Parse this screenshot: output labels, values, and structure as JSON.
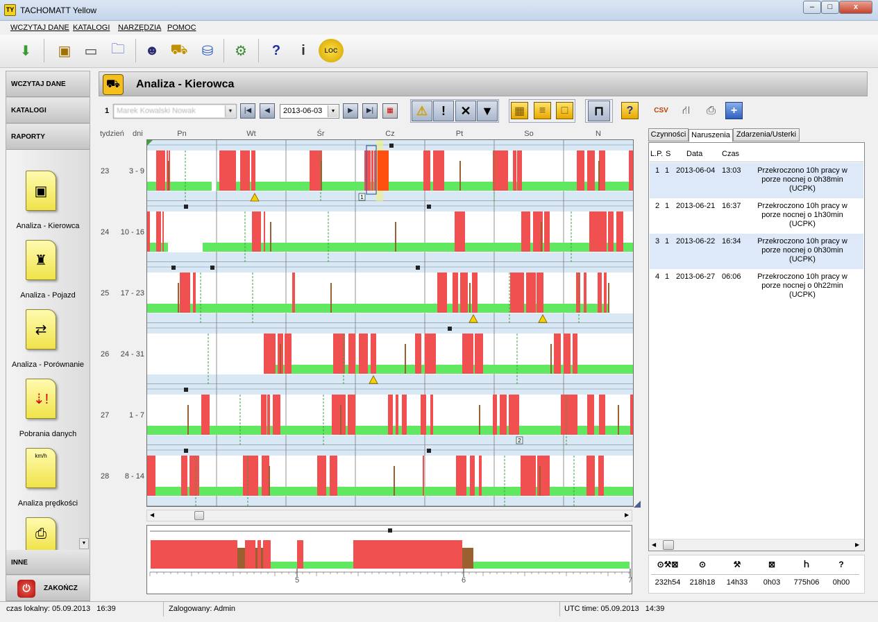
{
  "window": {
    "title": "TACHOMATT Yellow",
    "minimize": "–",
    "maximize": "□",
    "close": "x"
  },
  "menu": [
    "WCZYTAJ DANE",
    "KATALOGI",
    "NARZĘDZIA",
    "POMOC"
  ],
  "toolbar": {
    "icons": [
      "download-icon",
      "card-reader-icon",
      "card-icon",
      "folder-open-icon",
      "driver-icon",
      "truck-icon",
      "database-icon",
      "settings-gears-icon",
      "help-icon",
      "info-icon",
      "loc-clock-icon"
    ],
    "loc_label": "LOC"
  },
  "sidebar": {
    "sections": [
      "WCZYTAJ DANE",
      "KATALOGI",
      "RAPORTY"
    ],
    "reports": [
      {
        "label": "Analiza - Kierowca",
        "icon": "driver-analysis-icon"
      },
      {
        "label": "Analiza - Pojazd",
        "icon": "vehicle-analysis-icon"
      },
      {
        "label": "Analiza - Porównanie",
        "icon": "comparison-icon"
      },
      {
        "label": "Pobrania danych",
        "icon": "data-download-icon"
      },
      {
        "label": "Analiza prędkości",
        "icon": "speed-analysis-icon",
        "badge": "km/h"
      },
      {
        "label": "",
        "icon": "printer-icon"
      }
    ],
    "inne": "INNE",
    "exit": "ZAKOŃCZ"
  },
  "header": {
    "title": "Analiza - Kierowca"
  },
  "controls": {
    "driver_number": "1",
    "driver_name": "Marek Kowalski Nowak",
    "date": "2013-06-03",
    "buttons": [
      "first-button",
      "prev-button",
      "next-button",
      "last-button",
      "calendar-button"
    ],
    "filters": [
      "warning-filter",
      "exclamation-filter",
      "x-filter",
      "triangle-filter"
    ],
    "views": [
      "grid-view",
      "list-view",
      "single-view"
    ]
  },
  "chart": {
    "week_col": "tydzień",
    "days_col": "dni",
    "days": [
      "Pn",
      "Wt",
      "Śr",
      "Cz",
      "Pt",
      "So",
      "N"
    ],
    "weeks": [
      {
        "week": "23",
        "range": "3 - 9"
      },
      {
        "week": "24",
        "range": "10 - 16"
      },
      {
        "week": "25",
        "range": "17 - 23"
      },
      {
        "week": "26",
        "range": "24 - 31"
      },
      {
        "week": "27",
        "range": "1 - 7"
      },
      {
        "week": "28",
        "range": "8 - 14"
      }
    ],
    "markers": [
      "1",
      "2"
    ],
    "colors": {
      "driving": "#f05050",
      "rest": "#60e860",
      "work": "#9a6030",
      "bar": "#d8e8f4"
    }
  },
  "detail": {
    "ticks": [
      "5",
      "6",
      "7"
    ]
  },
  "tabs": [
    "Czynności",
    "Naruszenia",
    "Zdarzenia/Usterki"
  ],
  "violations": {
    "headers": {
      "lp": "L.P.",
      "s": "S",
      "date": "Data",
      "time": "Czas"
    },
    "rows": [
      {
        "lp": "1",
        "s": "1",
        "date": "2013-06-04",
        "time": "13:03",
        "l1": "Przekroczono 10h pracy w",
        "l2": "porze nocnej o 0h38min",
        "l3": "(UCPK)"
      },
      {
        "lp": "2",
        "s": "1",
        "date": "2013-06-21",
        "time": "16:37",
        "l1": "Przekroczono 10h pracy w",
        "l2": "porze nocnej o 1h30min",
        "l3": "(UCPK)"
      },
      {
        "lp": "3",
        "s": "1",
        "date": "2013-06-22",
        "time": "16:34",
        "l1": "Przekroczono 10h pracy w",
        "l2": "porze nocnej o 0h30min",
        "l3": "(UCPK)"
      },
      {
        "lp": "4",
        "s": "1",
        "date": "2013-06-27",
        "time": "06:06",
        "l1": "Przekroczono 10h pracy w",
        "l2": "porze nocnej o 0h22min",
        "l3": "(UCPK)"
      }
    ]
  },
  "summary": {
    "icons": [
      "⊙⚒⊠",
      "⊙",
      "⚒",
      "⊠",
      "Ⴙ",
      "?"
    ],
    "values": [
      "232h54",
      "218h18",
      "14h33",
      "0h03",
      "775h06",
      "0h00"
    ]
  },
  "status": {
    "local": "czas lokalny: 05.09.2013   16:39",
    "user": "Zalogowany: Admin",
    "utc": "UTC time: 05.09.2013   14:39"
  }
}
